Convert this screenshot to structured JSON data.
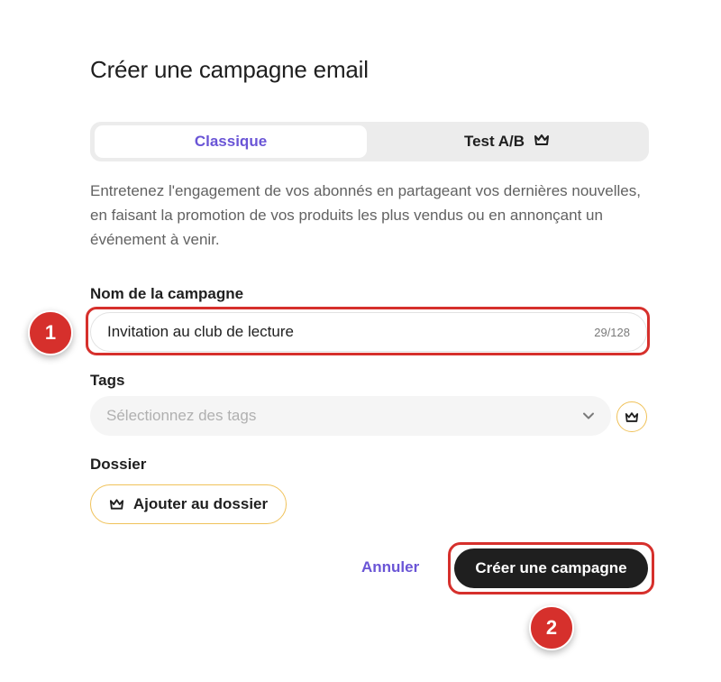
{
  "page": {
    "title": "Créer une campagne email"
  },
  "tabs": [
    {
      "label": "Classique",
      "selected": true
    },
    {
      "label": "Test A/B",
      "selected": false,
      "icon": "crown-icon"
    }
  ],
  "description": "Entretenez l'engagement de vos abonnés en partageant vos dernières nouvelles, en faisant la promotion de vos produits les plus vendus ou en annonçant un événement à venir.",
  "campaign_name": {
    "label": "Nom de la campagne",
    "value": "Invitation au club de lecture",
    "counter": "29/128"
  },
  "tags": {
    "label": "Tags",
    "placeholder": "Sélectionnez des tags"
  },
  "folder": {
    "label": "Dossier",
    "button_label": "Ajouter au dossier"
  },
  "actions": {
    "cancel_label": "Annuler",
    "create_label": "Créer une campagne"
  },
  "markers": [
    "1",
    "2"
  ],
  "colors": {
    "accent": "#6a55d6",
    "highlight": "#d6302c",
    "premium": "#f0c25a",
    "primary_button": "#1f1f1f"
  }
}
